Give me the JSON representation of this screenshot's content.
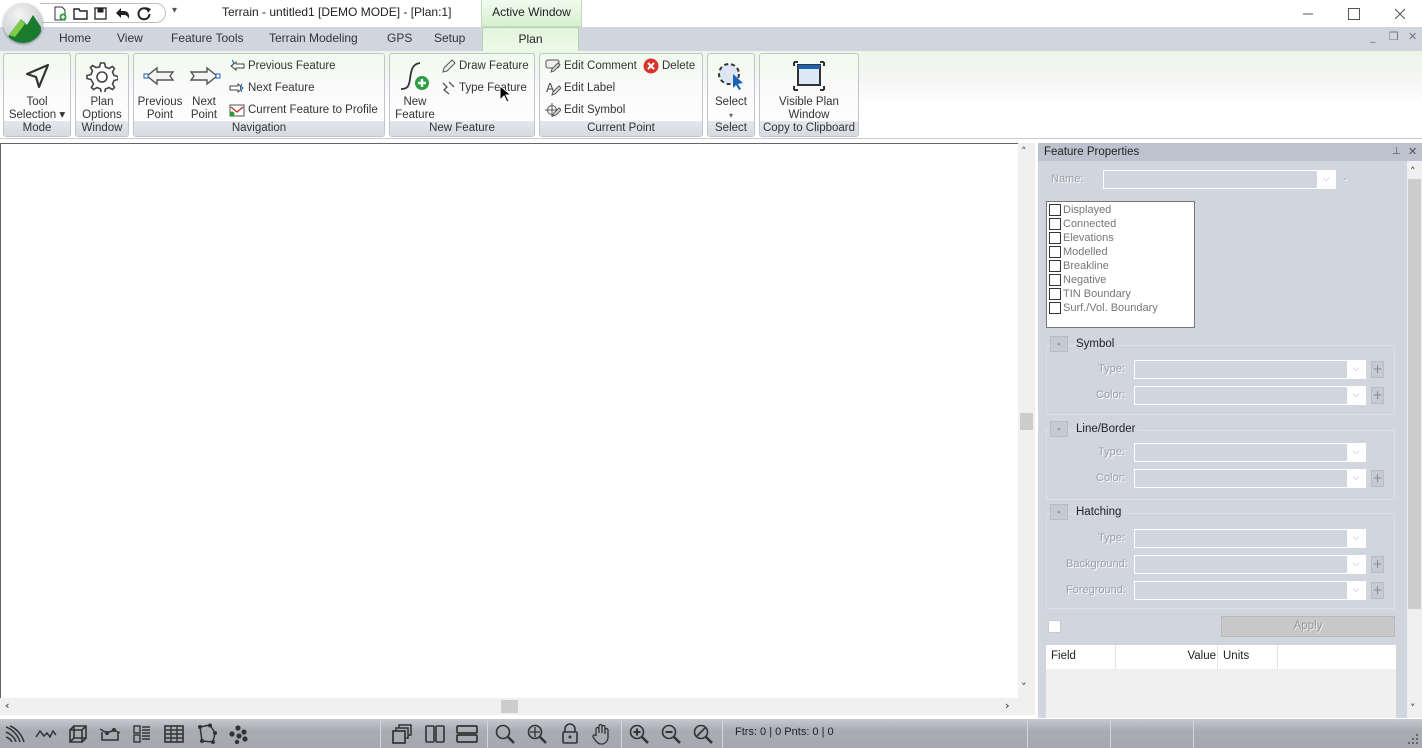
{
  "app": {
    "title": "Terrain - untitled1 [DEMO MODE] - [Plan:1]",
    "context_tab": "Active Window",
    "accent_color": "#1f8f3a"
  },
  "quick_access": {
    "icons": [
      "new-file-icon",
      "open-folder-icon",
      "save-icon",
      "undo-icon",
      "redo-icon"
    ],
    "more": "▾"
  },
  "window_controls": {
    "minimize": "—",
    "maximize": "☐",
    "close": "✕"
  },
  "mdi_controls": {
    "minimize": "_",
    "restore": "❐",
    "close": "✕"
  },
  "tabs": [
    {
      "label": "Home"
    },
    {
      "label": "View"
    },
    {
      "label": "Feature Tools"
    },
    {
      "label": "Terrain Modeling"
    },
    {
      "label": "GPS"
    },
    {
      "label": "Setup"
    },
    {
      "label": "Plan",
      "active": true
    }
  ],
  "ribbon": {
    "groups": {
      "mode": {
        "label": "Mode",
        "tool_selection_1": "Tool",
        "tool_selection_2": "Selection ▾"
      },
      "window": {
        "label": "Window",
        "plan_options_1": "Plan",
        "plan_options_2": "Options"
      },
      "navigation": {
        "label": "Navigation",
        "previous_point_1": "Previous",
        "previous_point_2": "Point",
        "next_point_1": "Next",
        "next_point_2": "Point",
        "previous_feature": "Previous Feature",
        "next_feature": "Next Feature",
        "current_feature_to_profile": "Current Feature to Profile"
      },
      "new_feature": {
        "label": "New Feature",
        "new_feature_1": "New",
        "new_feature_2": "Feature",
        "draw_feature": "Draw Feature",
        "type_feature": "Type Feature"
      },
      "current_point": {
        "label": "Current Point",
        "edit_comment": "Edit Comment",
        "delete": "Delete",
        "edit_label": "Edit Label",
        "edit_symbol": "Edit Symbol"
      },
      "select": {
        "label": "Select",
        "select": "Select",
        "arrow": "▾"
      },
      "clipboard": {
        "label": "Copy to Clipboard",
        "visible_plan_1": "Visible Plan",
        "visible_plan_2": "Window"
      }
    }
  },
  "panel": {
    "title": "Feature Properties",
    "pin": "⊥",
    "close": "✕",
    "name_label": "Name:",
    "name_value": "",
    "name_suffix": "-",
    "flags": [
      {
        "label": "Displayed",
        "checked": false
      },
      {
        "label": "Connected",
        "checked": false
      },
      {
        "label": "Elevations",
        "checked": false
      },
      {
        "label": "Modelled",
        "checked": false
      },
      {
        "label": "Breakline",
        "checked": false
      },
      {
        "label": "Negative",
        "checked": false
      },
      {
        "label": "TIN Boundary",
        "checked": false
      },
      {
        "label": "Surf./Vol. Boundary",
        "checked": false
      }
    ],
    "symbol": {
      "title": "Symbol",
      "collapse": "-",
      "type_label": "Type:",
      "color_label": "Color:"
    },
    "line_border": {
      "title": "Line/Border",
      "collapse": "-",
      "type_label": "Type:",
      "color_label": "Color:"
    },
    "hatching": {
      "title": "Hatching",
      "collapse": "-",
      "type_label": "Type:",
      "background_label": "Background:",
      "foreground_label": "Foreground:"
    },
    "plus": "+",
    "dropdown": "⌵",
    "apply": "Apply",
    "table": {
      "columns": [
        "Field",
        "Value",
        "Units"
      ],
      "rows": []
    }
  },
  "statusbar": {
    "left_icons": [
      "contours-icon",
      "profile-line-icon",
      "3d-box-icon",
      "breakline-icon",
      "layers-icon",
      "grid-table-icon",
      "polygon-icon",
      "points-icon"
    ],
    "window_icons": [
      "cascade-icon",
      "tile-vertical-icon",
      "tile-horizontal-icon"
    ],
    "view_icons": [
      "zoom-icon",
      "zoom-extents-icon",
      "lock-icon",
      "pan-hand-icon"
    ],
    "zoom_icons": [
      "zoom-in-icon",
      "zoom-out-icon",
      "zoom-reset-icon"
    ],
    "text": "Ftrs: 0 | 0  Pnts: 0 | 0"
  }
}
